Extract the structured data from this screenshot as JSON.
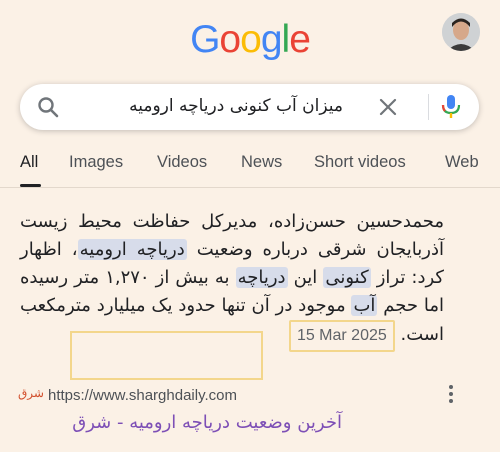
{
  "logo": {
    "letters": [
      "G",
      "o",
      "o",
      "g",
      "l",
      "e"
    ],
    "colors": [
      "#4285f4",
      "#ea4335",
      "#fbbc05",
      "#4285f4",
      "#34a853",
      "#ea4335"
    ]
  },
  "search": {
    "query": "میزان آب کنونی دریاچه ارومیه"
  },
  "tabs": [
    "All",
    "Images",
    "Videos",
    "News",
    "Short videos",
    "Web"
  ],
  "snippet": {
    "line_a": "محمدحسین حسن‌زاده، مدیرکل حفاظت محیط زیست آذربایجان شرقی درباره وضعیت ",
    "hl_1": "دریاچه ارومیه",
    "line_b": "، اظهار کرد: تراز ",
    "hl_2": "کنونی",
    "line_c": " این ",
    "hl_3": "دریاچه",
    "line_d": " به بیش از ۱,۲۷۰ متر رسیده اما حجم ",
    "hl_4": "آب",
    "line_e": " موجود در آن تنها حدود یک میلیارد مترمکعب است.",
    "date": "15 Mar 2025"
  },
  "source": {
    "favicon": "شرق",
    "url": "https://www.sharghdaily.com"
  },
  "result_title": "آخرین وضعیت دریاچه ارومیه - شرق"
}
